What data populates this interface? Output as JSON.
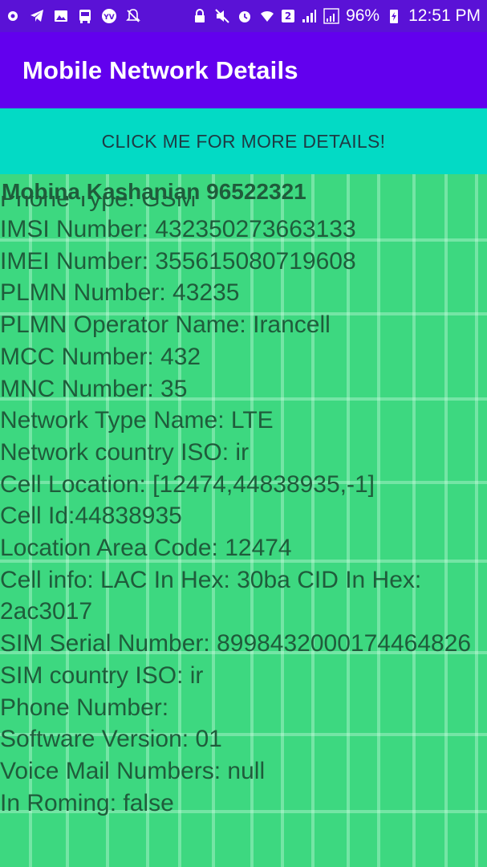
{
  "status_bar": {
    "time": "12:51 PM",
    "battery": "96%",
    "sim_slot": "2",
    "left_icons": [
      "settings-gear-icon",
      "telegram-icon",
      "image-icon",
      "bus-icon",
      "vyv-badge-icon",
      "notifications-off-icon"
    ],
    "right_icons": [
      "lock-icon",
      "mute-icon",
      "alarm-icon",
      "wifi-icon",
      "signal-icon",
      "signal-icon",
      "battery-charging-icon"
    ]
  },
  "app_bar": {
    "title": "Mobile Network Details"
  },
  "action_button": {
    "label": "CLICK ME FOR MORE DETAILS!"
  },
  "content": {
    "name": "Mobina Kashanian 96522321",
    "lines": [
      " Phone Type: GSM",
      " IMSI Number: 432350273663133",
      " IMEI Number: 355615080719608",
      " PLMN Number: 43235",
      " PLMN Operator Name: Irancell",
      " MCC Number: 432",
      " MNC Number: 35",
      " Network Type Name: LTE",
      " Network country ISO: ir",
      " Cell Location: [12474,44838935,-1]",
      " Cell Id:44838935",
      " Location Area Code: 12474",
      " Cell info: LAC In Hex: 30ba CID In Hex: 2ac3017",
      " SIM Serial Number: 8998432000174464826",
      " SIM country ISO: ir",
      " Phone Number:",
      " Software Version: 01",
      " Voice Mail Numbers: null",
      " In Roming: false"
    ]
  },
  "colors": {
    "status_bar": "#5a12d6",
    "app_bar": "#6200ee",
    "button": "#03dac5",
    "content_bg": "#3dd880",
    "content_text": "#1f5c3b"
  }
}
